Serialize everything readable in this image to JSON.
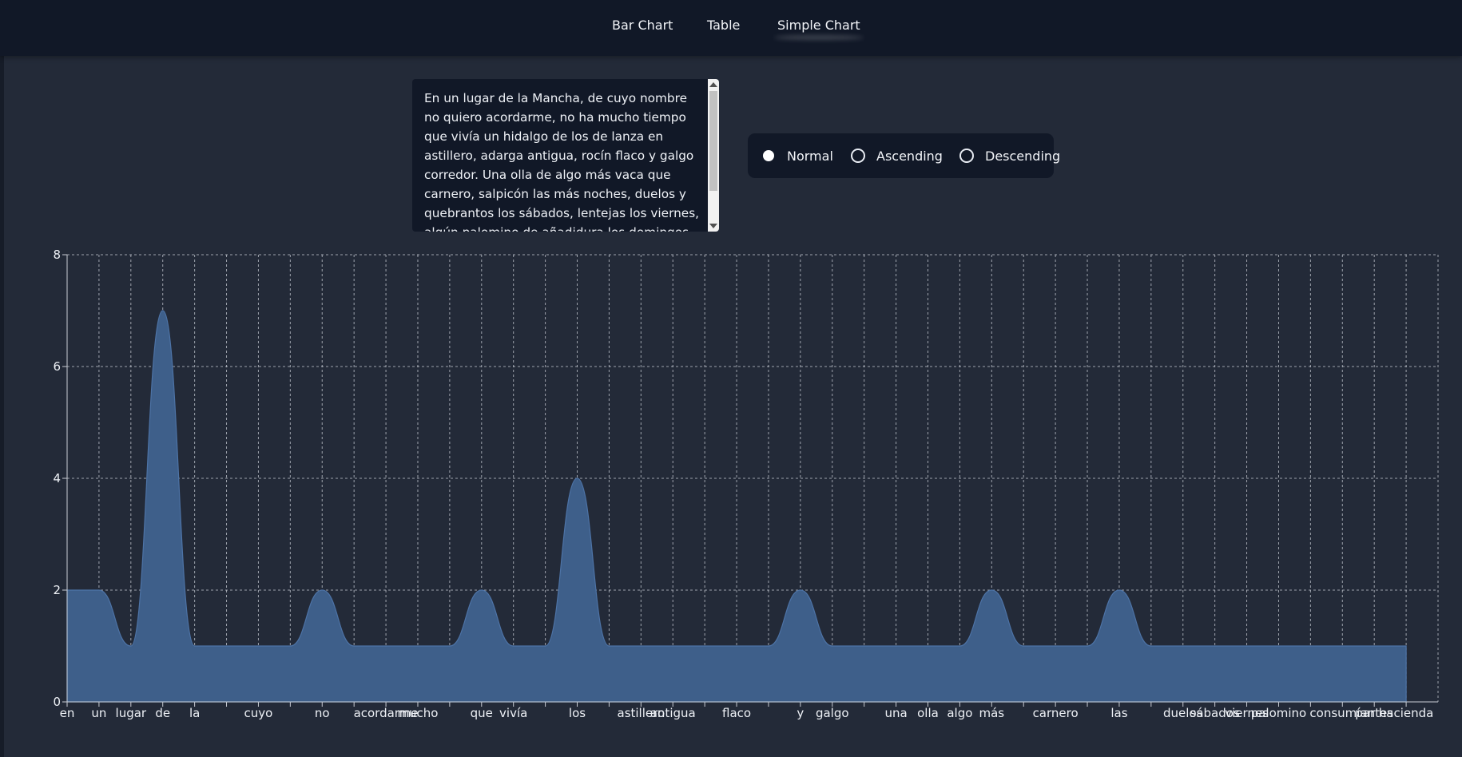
{
  "nav": {
    "items": [
      "Bar Chart",
      "Table",
      "Simple Chart"
    ],
    "active": "Simple Chart"
  },
  "textarea": {
    "value": "En un lugar de la Mancha, de cuyo nombre no quiero acordarme, no ha mucho tiempo que vivía un hidalgo de los de lanza en astillero, adarga antigua, rocín flaco y galgo corredor. Una olla de algo más vaca que carnero, salpicón las más noches, duelos y quebrantos los sábados, lentejas los viernes, algún palomino de añadidura los domingos, consumían las tres partes de su hacienda."
  },
  "sort": {
    "options": [
      "Normal",
      "Ascending",
      "Descending"
    ],
    "selected": "Normal"
  },
  "colors": {
    "area_fill": "#3e5f8a",
    "area_stroke": "#4d73a6",
    "grid": "#c8ccd4",
    "background": "#232a38"
  },
  "chart_data": {
    "type": "area",
    "smooth": true,
    "x": [
      "en",
      "un",
      "lugar",
      "de",
      "la",
      "la",
      "cuyo",
      "cuyo",
      "no",
      "no",
      "acordarme",
      "mucho",
      "mucho",
      "que",
      "vivía",
      "vivía",
      "los",
      "los",
      "astillero",
      "antigua",
      "antigua",
      "flaco",
      "flaco",
      "y",
      "galgo",
      "galgo",
      "una",
      "olla",
      "algo",
      "más",
      "más",
      "carnero",
      "carnero",
      "las",
      "las",
      "duelos",
      "sábados",
      "viernes",
      "palomino",
      "palomino",
      "consumían",
      "partes",
      "hacienda"
    ],
    "visible_tick_labels": [
      "en",
      "un",
      "lugar",
      "de",
      "la",
      "cuyo",
      "no",
      "acordarme",
      "mucho",
      "que",
      "vivía",
      "los",
      "astillero",
      "antigua",
      "flaco",
      "y",
      "galgo",
      "una",
      "olla",
      "algo",
      "más",
      "carnero",
      "las",
      "duelos",
      "sábados",
      "viernes",
      "palomino",
      "consumían",
      "partes",
      "hacienda"
    ],
    "values": [
      2,
      2,
      1,
      7,
      1,
      1,
      1,
      1,
      2,
      1,
      1,
      1,
      1,
      2,
      1,
      1,
      4,
      1,
      1,
      1,
      1,
      1,
      1,
      2,
      1,
      1,
      1,
      1,
      1,
      2,
      1,
      1,
      1,
      2,
      1,
      1,
      1,
      1,
      1,
      1,
      1,
      1,
      1
    ],
    "ylim": [
      0,
      8
    ],
    "yticks": [
      0,
      2,
      4,
      6,
      8
    ],
    "grid": true,
    "legend": "none"
  }
}
